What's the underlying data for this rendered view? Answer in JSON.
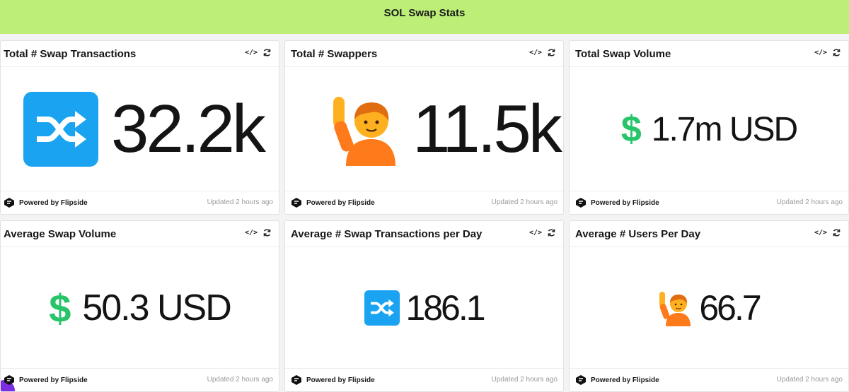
{
  "banner": {
    "title": "SOL Swap Stats"
  },
  "colors": {
    "banner_bg": "#bcee78",
    "shuffle_blue": "#1aa3f0",
    "dollar_green": "#27c46a",
    "person_orange": "#ff7a1a"
  },
  "footer": {
    "brand": "Powered by Flipside",
    "updated": "Updated 2 hours ago"
  },
  "cards": [
    {
      "title": "Total # Swap Transactions",
      "icon": "shuffle-icon",
      "value": "32.2k"
    },
    {
      "title": "Total # Swappers",
      "icon": "person-raising-hand-icon",
      "value": "11.5k"
    },
    {
      "title": "Total Swap Volume",
      "icon": "dollar-icon",
      "value": "1.7m USD"
    },
    {
      "title": "Average Swap Volume",
      "icon": "dollar-icon",
      "value": "50.3 USD"
    },
    {
      "title": "Average # Swap Transactions per Day",
      "icon": "shuffle-icon",
      "value": "186.1"
    },
    {
      "title": "Average # Users Per Day",
      "icon": "person-raising-hand-icon",
      "value": "66.7"
    }
  ]
}
